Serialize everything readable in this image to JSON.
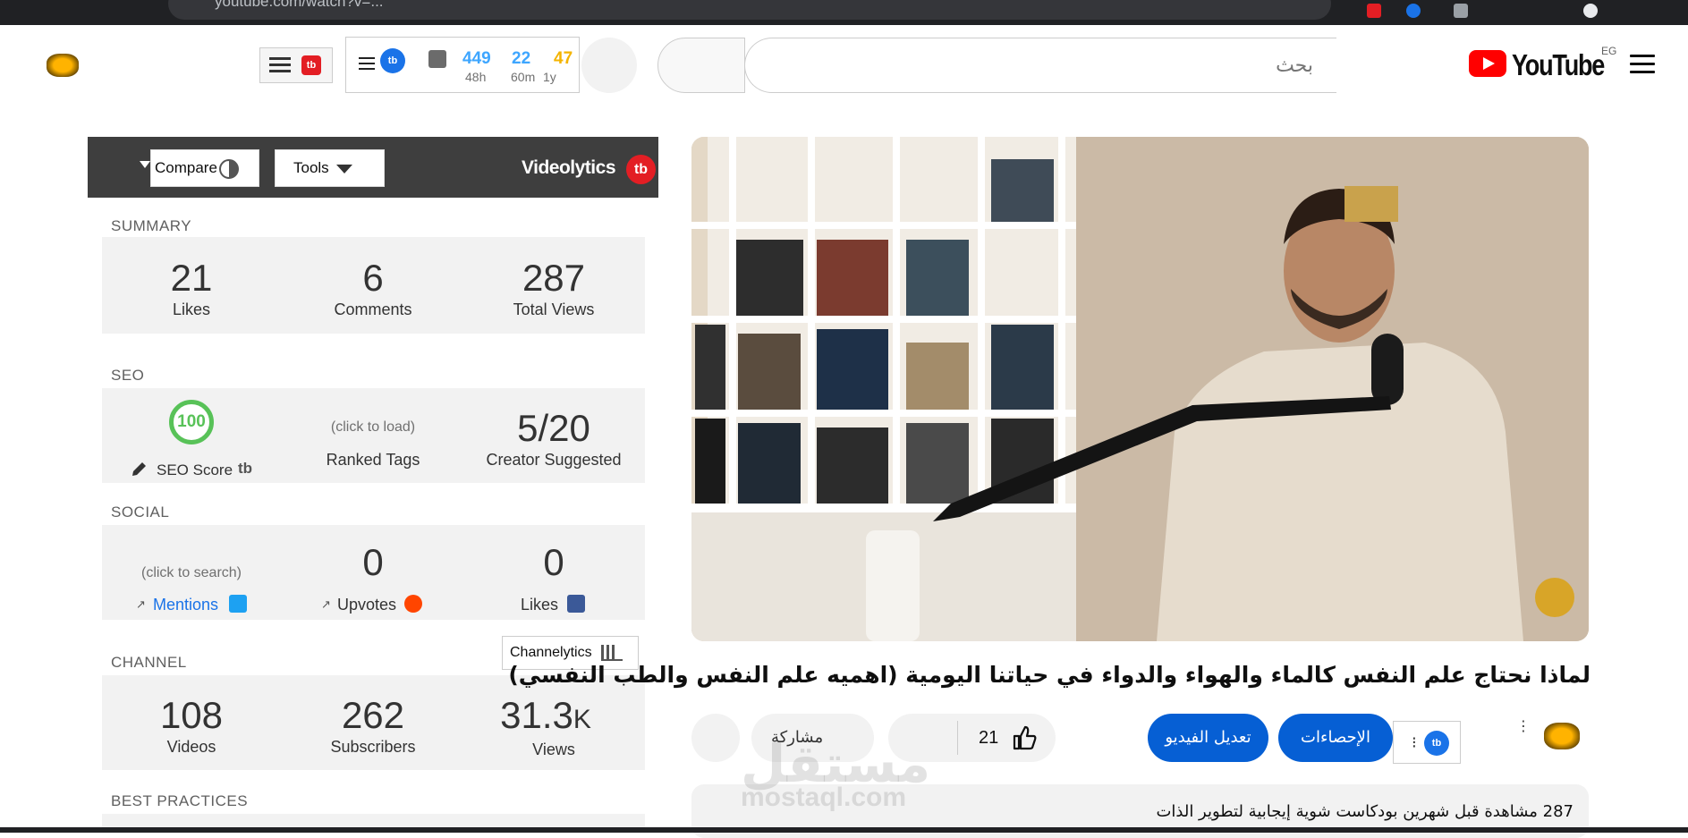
{
  "browser": {
    "url": "youtube.com/watch?v=..."
  },
  "masthead": {
    "logo_text": "YouTube",
    "country": "EG",
    "search_placeholder": "بحث"
  },
  "tubebuddy": {
    "badge": "tb",
    "stats": [
      {
        "value": "449",
        "label": "48h",
        "color": "#3ea6ff"
      },
      {
        "value": "22",
        "label": "60m",
        "color": "#3ea6ff"
      },
      {
        "value": "47",
        "label": "1y",
        "color": "#f4b400"
      }
    ]
  },
  "videolytics": {
    "compare_label": "Compare",
    "tools_label": "Tools",
    "title": "Videolytics",
    "logo": "tb",
    "summary": {
      "title": "SUMMARY",
      "items": [
        {
          "value": "21",
          "label": "Likes"
        },
        {
          "value": "6",
          "label": "Comments"
        },
        {
          "value": "287",
          "label": "Total Views"
        }
      ]
    },
    "seo": {
      "title": "SEO",
      "score": "100",
      "score_label": "SEO Score",
      "ranked_hint": "(click to load)",
      "ranked_label": "Ranked Tags",
      "creator_value": "5/20",
      "creator_label": "Creator Suggested"
    },
    "social": {
      "title": "SOCIAL",
      "mentions_hint": "(click to search)",
      "mentions_label": "Mentions",
      "upvotes_value": "0",
      "upvotes_label": "Upvotes",
      "likes_value": "0",
      "likes_label": "Likes"
    },
    "channel": {
      "title": "CHANNEL",
      "channelytics_label": "Channelytics",
      "items": [
        {
          "value": "108",
          "label": "Videos"
        },
        {
          "value": "262",
          "label": "Subscribers"
        },
        {
          "value": "31.3",
          "suffix": "K",
          "label": "Views"
        }
      ]
    },
    "best_practices_title": "BEST PRACTICES"
  },
  "video": {
    "title": "لماذا نحتاج علم النفس كالماء والهواء والدواء في حياتنا اليومية (اهميه علم النفس والطب النفسي)",
    "like_count": "21",
    "share_label": "مشاركة",
    "edit_label": "تعديل الفيديو",
    "stats_label": "الإحصاءات",
    "description_line": "287 مشاهدة  قبل شهرين  بودكاست شوية إيجابية لتطوير الذات"
  },
  "watermark": {
    "brand": "مستقل",
    "url": "mostaql.com"
  }
}
